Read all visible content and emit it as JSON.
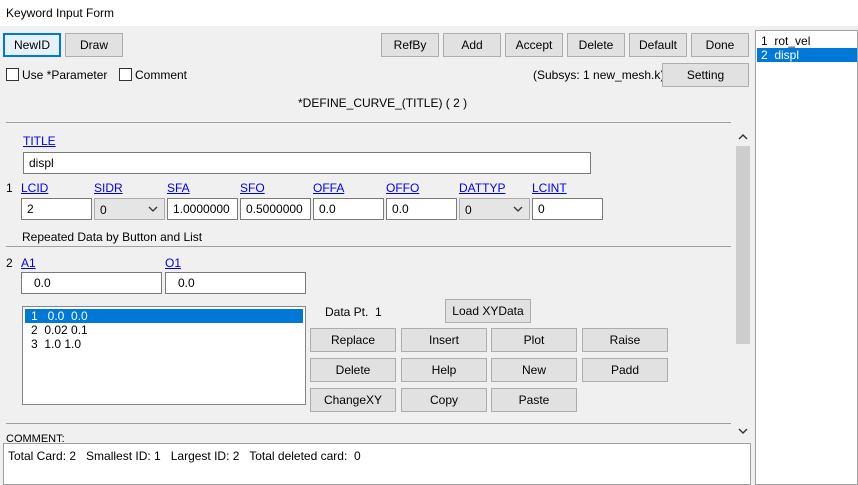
{
  "window": {
    "title": "Keyword Input Form"
  },
  "toolbar": {
    "newid": "NewID",
    "draw": "Draw",
    "refby": "RefBy",
    "add": "Add",
    "accept": "Accept",
    "delete": "Delete",
    "default": "Default",
    "done": "Done"
  },
  "options": {
    "use_parameter": "Use *Parameter",
    "comment": "Comment",
    "subsys": "(Subsys: 1 new_mesh.k)",
    "setting": "Setting"
  },
  "keyword_header": "*DEFINE_CURVE_(TITLE)   ( 2 )",
  "title_card": {
    "label": "TITLE",
    "value": "displ"
  },
  "card1": {
    "row_number": "1",
    "headers": [
      "LCID",
      "SIDR",
      "SFA",
      "SFO",
      "OFFA",
      "OFFO",
      "DATTYP",
      "LCINT"
    ],
    "values": [
      "2",
      "0",
      "1.0000000",
      "0.5000000",
      "0.0",
      "0.0",
      "0",
      "0"
    ]
  },
  "repeated_label": "Repeated Data by Button and List",
  "card2": {
    "row_number": "2",
    "headers": [
      "A1",
      "O1"
    ],
    "values": [
      "0.0",
      "0.0"
    ]
  },
  "data_list": [
    "1   0.0  0.0",
    "2  0.02 0.1",
    "3  1.0 1.0"
  ],
  "data_pt": {
    "label": "Data Pt.",
    "value": "1"
  },
  "buttons": {
    "load_xy": "Load XYData",
    "replace": "Replace",
    "insert": "Insert",
    "plot": "Plot",
    "raise": "Raise",
    "delete": "Delete",
    "help": "Help",
    "new": "New",
    "padd": "Padd",
    "changexy": "ChangeXY",
    "copy": "Copy",
    "paste": "Paste"
  },
  "comment_label": "COMMENT:",
  "status": "Total Card: 2   Smallest ID: 1   Largest ID: 2   Total deleted card:  0",
  "id_list": [
    "1  rot_vel",
    "2  displ"
  ],
  "colors": {
    "selection": "#0078d7",
    "link": "#0000ee",
    "focus_border": "#0078d7"
  }
}
